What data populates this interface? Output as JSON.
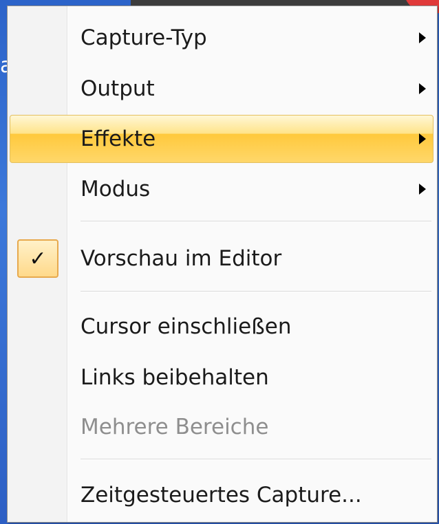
{
  "background": {
    "text": "apture"
  },
  "menu": {
    "items": [
      {
        "label": "Capture-Typ",
        "has_submenu": true,
        "state": "normal"
      },
      {
        "label": "Output",
        "has_submenu": true,
        "state": "normal"
      },
      {
        "label": "Effekte",
        "has_submenu": true,
        "state": "highlighted"
      },
      {
        "label": "Modus",
        "has_submenu": true,
        "state": "normal"
      },
      {
        "label": "Vorschau im Editor",
        "has_submenu": false,
        "state": "checked"
      },
      {
        "label": "Cursor einschließen",
        "has_submenu": false,
        "state": "normal"
      },
      {
        "label": "Links beibehalten",
        "has_submenu": false,
        "state": "normal"
      },
      {
        "label": "Mehrere Bereiche",
        "has_submenu": false,
        "state": "disabled"
      },
      {
        "label": "Zeitgesteuertes Capture...",
        "has_submenu": false,
        "state": "normal"
      }
    ],
    "check_glyph": "✓",
    "arrow_icon": "submenu-arrow-icon"
  },
  "colors": {
    "highlight_top": "#fff7d6",
    "highlight_mid": "#ffc93c",
    "highlight_border": "#e3bf5e",
    "disabled_text": "#8e8e8e",
    "text": "#1b1b1b"
  }
}
